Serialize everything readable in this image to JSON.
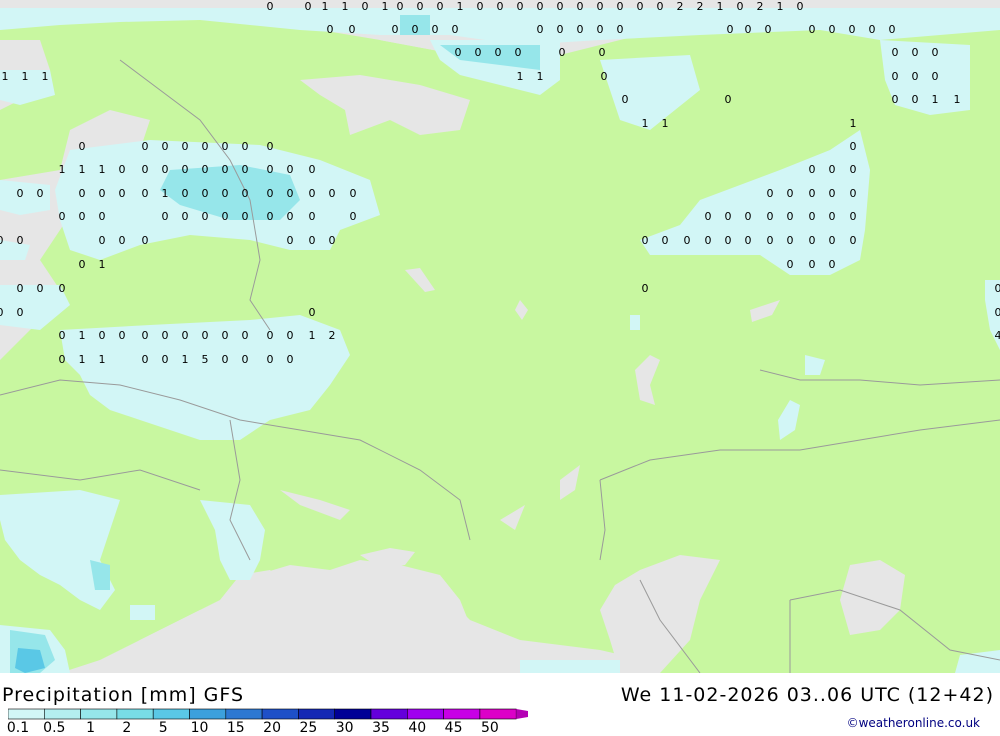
{
  "title": "Precipitation [mm] GFS",
  "valid_time": "We 11-02-2026 03..06 UTC (12+42)",
  "credit": "©weatheronline.co.uk",
  "colors": {
    "land": "#c8f7a0",
    "sea": "#e6e6e6",
    "border": "#9a9a9a",
    "precip_light": "#d2f6f6"
  },
  "legend": {
    "labels": [
      "0.1",
      "0.5",
      "1",
      "2",
      "5",
      "10",
      "15",
      "20",
      "25",
      "30",
      "35",
      "40",
      "45",
      "50"
    ],
    "colors": [
      "#d2f6f6",
      "#b4eef0",
      "#96e6ea",
      "#78dce6",
      "#5ac8e6",
      "#3ca0dc",
      "#2d78d2",
      "#1e50c8",
      "#1428b4",
      "#000096",
      "#6400dc",
      "#a000f0",
      "#c800e6",
      "#dc00c8"
    ]
  },
  "map_values": [
    {
      "t": "0"
    },
    {
      "t": "0"
    },
    {
      "t": "1"
    },
    {
      "t": "1"
    },
    {
      "t": "0"
    },
    {
      "t": "1"
    },
    {
      "t": "0"
    },
    {
      "t": "0"
    },
    {
      "t": "0"
    },
    {
      "t": "1"
    },
    {
      "t": "0"
    },
    {
      "t": "0"
    },
    {
      "t": "0"
    },
    {
      "t": "0"
    },
    {
      "t": "0"
    },
    {
      "t": "0"
    },
    {
      "t": "0"
    },
    {
      "t": "0"
    },
    {
      "t": "0"
    },
    {
      "t": "0"
    },
    {
      "t": "2"
    },
    {
      "t": "2"
    },
    {
      "t": "1"
    },
    {
      "t": "0"
    },
    {
      "t": "2"
    },
    {
      "t": "1"
    },
    {
      "t": "0"
    },
    {
      "t": "0"
    },
    {
      "t": "0"
    },
    {
      "t": "0"
    },
    {
      "t": "0"
    },
    {
      "t": "0"
    },
    {
      "t": "0"
    },
    {
      "t": "0"
    },
    {
      "t": "0"
    },
    {
      "t": "0"
    },
    {
      "t": "0"
    },
    {
      "t": "0"
    },
    {
      "t": "0"
    },
    {
      "t": "0"
    },
    {
      "t": "0"
    },
    {
      "t": "0"
    },
    {
      "t": "0"
    },
    {
      "t": "0"
    },
    {
      "t": "0"
    },
    {
      "t": "0"
    },
    {
      "t": "0"
    },
    {
      "t": "0"
    },
    {
      "t": "0"
    },
    {
      "t": "0"
    },
    {
      "t": "0"
    },
    {
      "t": "0"
    },
    {
      "t": "0"
    },
    {
      "t": "0"
    },
    {
      "t": "0"
    },
    {
      "t": "1"
    },
    {
      "t": "1"
    },
    {
      "t": "1"
    },
    {
      "t": "1"
    },
    {
      "t": "1"
    },
    {
      "t": "0"
    },
    {
      "t": "0"
    },
    {
      "t": "0"
    },
    {
      "t": "0"
    },
    {
      "t": "0"
    },
    {
      "t": "0"
    },
    {
      "t": "0"
    },
    {
      "t": "0"
    },
    {
      "t": "1"
    },
    {
      "t": "1"
    },
    {
      "t": "1"
    },
    {
      "t": "1"
    },
    {
      "t": "1"
    },
    {
      "t": "0"
    },
    {
      "t": "0"
    },
    {
      "t": "0"
    },
    {
      "t": "0"
    },
    {
      "t": "0"
    },
    {
      "t": "0"
    },
    {
      "t": "0"
    },
    {
      "t": "0"
    },
    {
      "t": "0"
    },
    {
      "t": "1"
    },
    {
      "t": "1"
    },
    {
      "t": "1"
    },
    {
      "t": "0"
    },
    {
      "t": "0"
    },
    {
      "t": "0"
    },
    {
      "t": "0"
    },
    {
      "t": "0"
    },
    {
      "t": "0"
    },
    {
      "t": "0"
    },
    {
      "t": "0"
    },
    {
      "t": "0"
    },
    {
      "t": "0"
    },
    {
      "t": "0"
    },
    {
      "t": "0"
    },
    {
      "t": "0"
    },
    {
      "t": "0"
    },
    {
      "t": "0"
    },
    {
      "t": "0"
    },
    {
      "t": "0"
    },
    {
      "t": "0"
    },
    {
      "t": "0"
    },
    {
      "t": "1"
    },
    {
      "t": "0"
    },
    {
      "t": "0"
    },
    {
      "t": "0"
    },
    {
      "t": "0"
    },
    {
      "t": "0"
    },
    {
      "t": "0"
    },
    {
      "t": "0"
    },
    {
      "t": "0"
    },
    {
      "t": "0"
    },
    {
      "t": "0"
    },
    {
      "t": "0"
    },
    {
      "t": "0"
    },
    {
      "t": "0"
    },
    {
      "t": "0"
    },
    {
      "t": "0"
    },
    {
      "t": "0"
    },
    {
      "t": "0"
    },
    {
      "t": "0"
    },
    {
      "t": "0"
    },
    {
      "t": "0"
    },
    {
      "t": "0"
    },
    {
      "t": "0"
    },
    {
      "t": "0"
    },
    {
      "t": "0"
    },
    {
      "t": "0"
    },
    {
      "t": "0"
    },
    {
      "t": "0"
    },
    {
      "t": "0"
    },
    {
      "t": "0"
    },
    {
      "t": "0"
    },
    {
      "t": "0"
    },
    {
      "t": "0"
    },
    {
      "t": "0"
    },
    {
      "t": "0"
    },
    {
      "t": "0"
    },
    {
      "t": "0"
    },
    {
      "t": "0"
    },
    {
      "t": "0"
    },
    {
      "t": "0"
    },
    {
      "t": "0"
    },
    {
      "t": "0"
    },
    {
      "t": "0"
    },
    {
      "t": "0"
    },
    {
      "t": "0"
    },
    {
      "t": "0"
    },
    {
      "t": "0"
    },
    {
      "t": "0"
    },
    {
      "t": "0"
    },
    {
      "t": "0"
    },
    {
      "t": "0"
    },
    {
      "t": "0"
    },
    {
      "t": "0"
    },
    {
      "t": "0"
    },
    {
      "t": "0"
    },
    {
      "t": "1"
    },
    {
      "t": "0"
    },
    {
      "t": "0"
    },
    {
      "t": "0"
    },
    {
      "t": "0"
    },
    {
      "t": "0"
    },
    {
      "t": "0"
    },
    {
      "t": "0"
    },
    {
      "t": "0"
    },
    {
      "t": "0"
    },
    {
      "t": "0"
    },
    {
      "t": "0"
    },
    {
      "t": "0"
    },
    {
      "t": "0"
    },
    {
      "t": "1"
    },
    {
      "t": "0"
    },
    {
      "t": "0"
    },
    {
      "t": "0"
    },
    {
      "t": "0"
    },
    {
      "t": "0"
    },
    {
      "t": "0"
    },
    {
      "t": "0"
    },
    {
      "t": "0"
    },
    {
      "t": "0"
    },
    {
      "t": "0"
    },
    {
      "t": "1"
    },
    {
      "t": "2"
    },
    {
      "t": "4"
    },
    {
      "t": "0"
    },
    {
      "t": "1"
    },
    {
      "t": "1"
    },
    {
      "t": "0"
    },
    {
      "t": "0"
    },
    {
      "t": "1"
    },
    {
      "t": "5"
    },
    {
      "t": "0"
    },
    {
      "t": "0"
    },
    {
      "t": "0"
    },
    {
      "t": "0"
    }
  ]
}
